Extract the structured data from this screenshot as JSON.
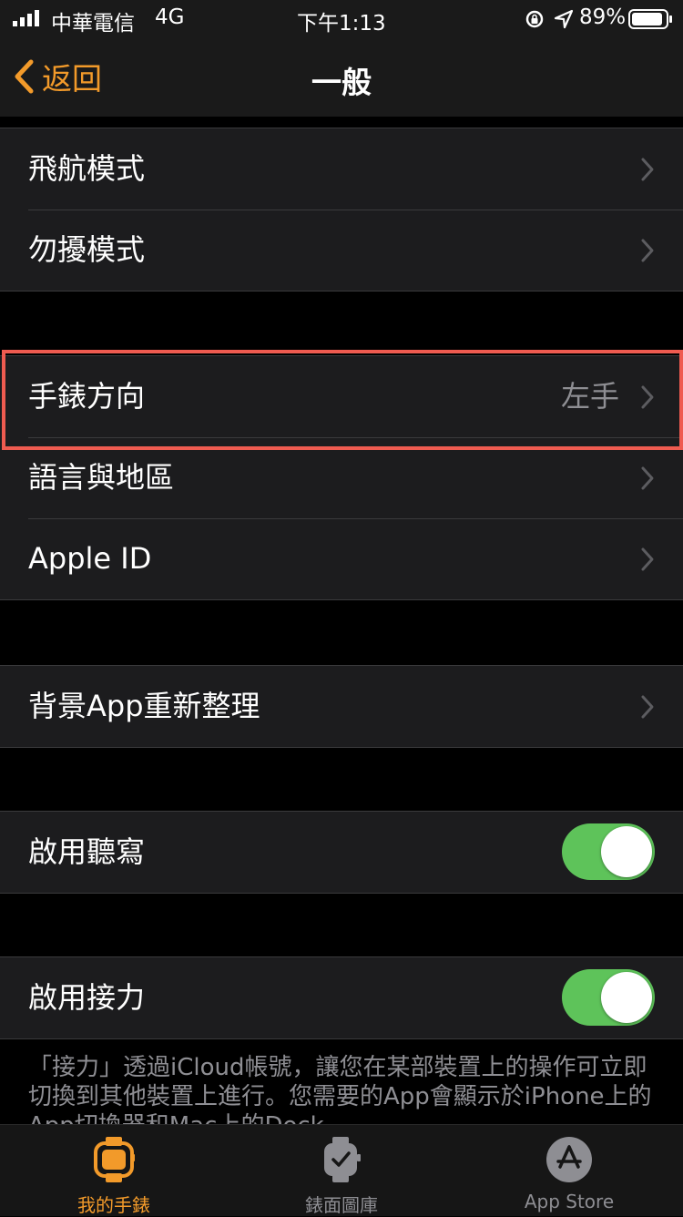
{
  "status_bar": {
    "carrier": "中華電信",
    "network": "4G",
    "time": "下午1:13",
    "battery": "89%"
  },
  "nav": {
    "back_label": "返回",
    "title": "一般"
  },
  "groups": [
    {
      "rows": [
        {
          "label": "飛航模式"
        },
        {
          "label": "勿擾模式"
        }
      ]
    },
    {
      "rows": [
        {
          "label": "手錶方向",
          "value": "左手"
        },
        {
          "label": "語言與地區"
        },
        {
          "label": "Apple ID"
        }
      ]
    },
    {
      "rows": [
        {
          "label": "背景App重新整理"
        }
      ]
    },
    {
      "rows": [
        {
          "label": "啟用聽寫",
          "toggle": true
        }
      ]
    },
    {
      "rows": [
        {
          "label": "啟用接力",
          "toggle": true
        }
      ]
    }
  ],
  "footnote": "「接力」透過iCloud帳號，讓您在某部裝置上的操作可立即切換到其他裝置上進行。您需要的App會顯示於iPhone上的App切換器和Mac上的Dock。",
  "tabs": [
    {
      "label": "我的手錶",
      "active": true
    },
    {
      "label": "錶面圖庫",
      "active": false
    },
    {
      "label": "App Store",
      "active": false
    }
  ],
  "colors": {
    "accent": "#f29a2a",
    "toggle_on": "#5ec35a",
    "highlight": "#ef5b50",
    "secondary_text": "#8e8e93"
  }
}
